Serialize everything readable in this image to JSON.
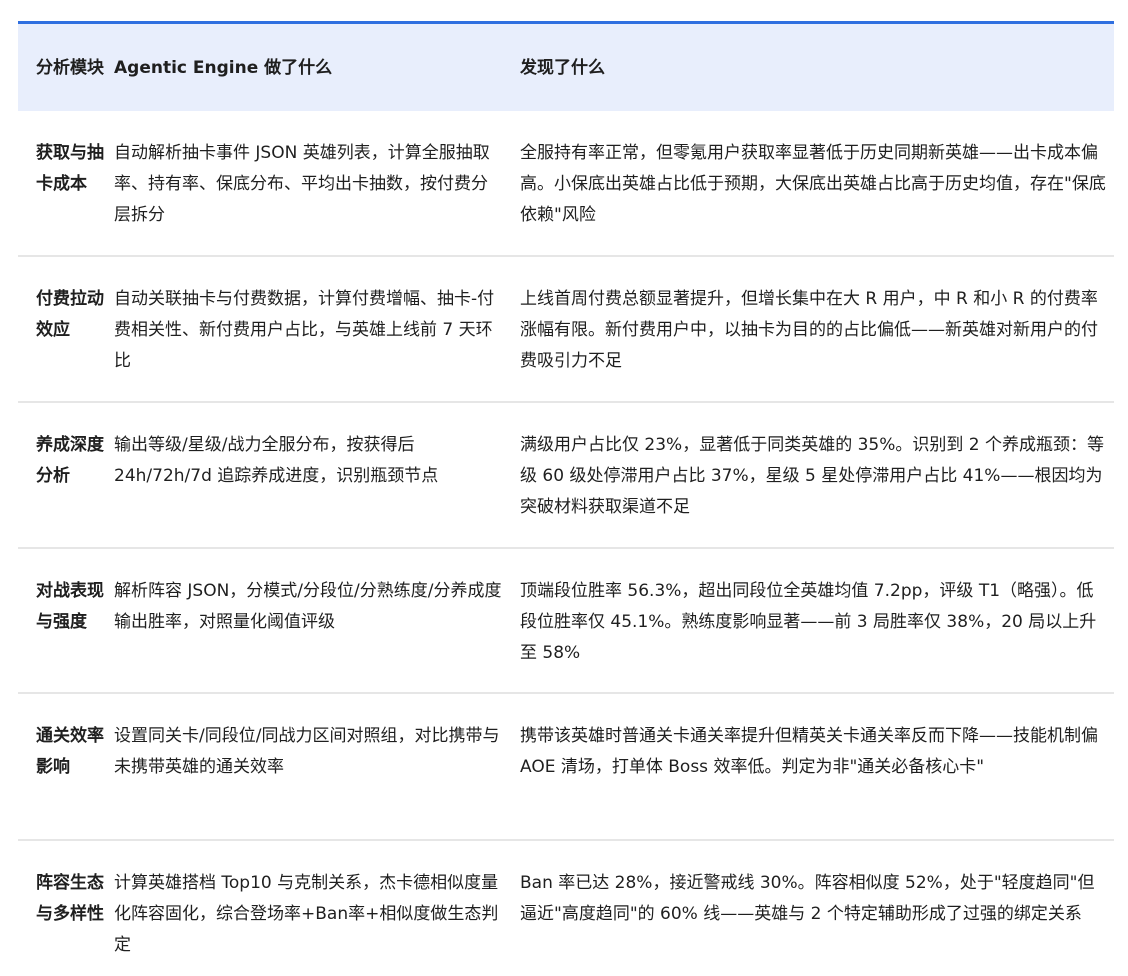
{
  "table": {
    "headers": {
      "module": "分析模块",
      "engine": "Agentic Engine 做了什么",
      "found": "发现了什么"
    },
    "rows": [
      {
        "module": "获取与抽卡成本",
        "engine": "自动解析抽卡事件 JSON 英雄列表，计算全服抽取率、持有率、保底分布、平均出卡抽数，按付费分层拆分",
        "found": "全服持有率正常，但零氪用户获取率显著低于历史同期新英雄——出卡成本偏高。小保底出英雄占比低于预期，大保底出英雄占比高于历史均值，存在\"保底依赖\"风险"
      },
      {
        "module": "付费拉动效应",
        "engine": "自动关联抽卡与付费数据，计算付费增幅、抽卡-付费相关性、新付费用户占比，与英雄上线前 7 天环比",
        "found": "上线首周付费总额显著提升，但增长集中在大 R 用户，中 R 和小 R 的付费率涨幅有限。新付费用户中，以抽卡为目的的占比偏低——新英雄对新用户的付费吸引力不足"
      },
      {
        "module": "养成深度分析",
        "engine": "输出等级/星级/战力全服分布，按获得后 24h/72h/7d 追踪养成进度，识别瓶颈节点",
        "found": "满级用户占比仅 23%，显著低于同类英雄的 35%。识别到 2 个养成瓶颈：等级 60 级处停滞用户占比 37%，星级 5 星处停滞用户占比 41%——根因均为突破材料获取渠道不足"
      },
      {
        "module": "对战表现与强度",
        "engine": "解析阵容 JSON，分模式/分段位/分熟练度/分养成度输出胜率，对照量化阈值评级",
        "found": "顶端段位胜率 56.3%，超出同段位全英雄均值 7.2pp，评级 T1（略强）。低段位胜率仅 45.1%。熟练度影响显著——前 3 局胜率仅 38%，20 局以上升至 58%"
      },
      {
        "module": "通关效率影响",
        "engine": "设置同关卡/同段位/同战力区间对照组，对比携带与未携带英雄的通关效率",
        "found": "携带该英雄时普通关卡通关率提升但精英关卡通关率反而下降——技能机制偏 AOE 清场，打单体 Boss 效率低。判定为非\"通关必备核心卡\""
      },
      {
        "module": "阵容生态与多样性",
        "engine": "计算英雄搭档 Top10 与克制关系，杰卡德相似度量化阵容固化，综合登场率+Ban率+相似度做生态判定",
        "found": "Ban 率已达 28%，接近警戒线 30%。阵容相似度 52%，处于\"轻度趋同\"但逼近\"高度趋同\"的 60% 线——英雄与 2 个特定辅助形成了过强的绑定关系"
      }
    ]
  }
}
